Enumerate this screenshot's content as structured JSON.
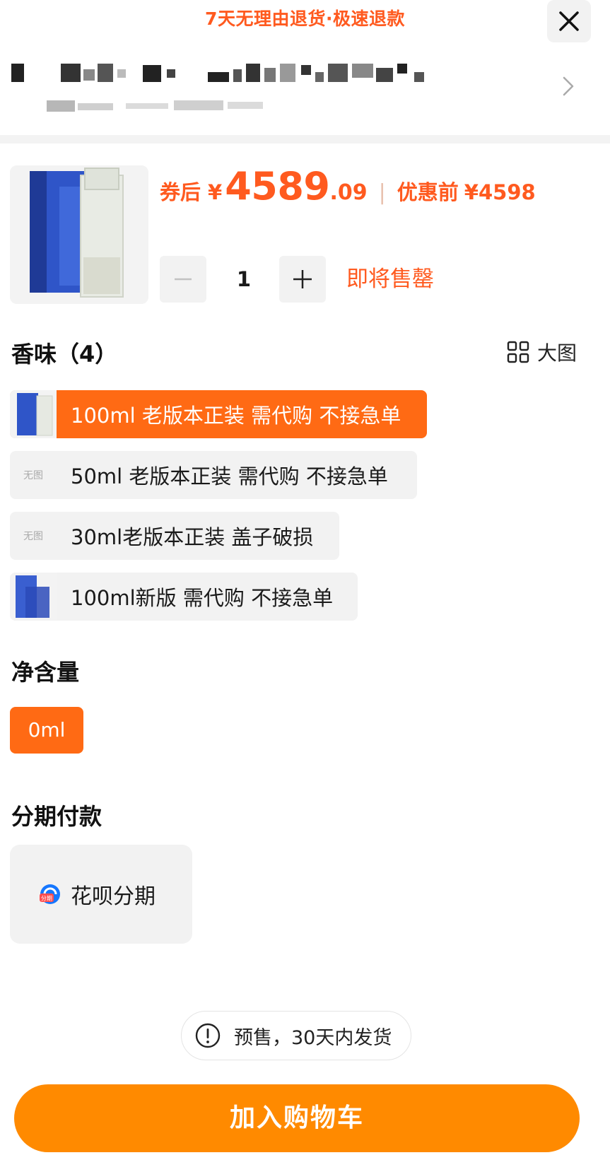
{
  "banner": {
    "text": "7天无理由退货·极速退款"
  },
  "product": {
    "price_label": "券后",
    "currency": "¥",
    "price_integer": "4589",
    "price_decimal": ".09",
    "original_label": "优惠前",
    "original_price": "¥4598",
    "quantity": "1",
    "stock_status": "即将售罄"
  },
  "scent": {
    "title": "香味（4）",
    "big_view_label": "大图",
    "options": [
      {
        "label": "100ml 老版本正装 需代购 不接急单",
        "image": "thumb",
        "selected": true
      },
      {
        "label": "50ml 老版本正装 需代购 不接急单",
        "image": "无图",
        "selected": false
      },
      {
        "label": "30ml老版本正装 盖子破损",
        "image": "无图",
        "selected": false
      },
      {
        "label": "100ml新版 需代购 不接急单",
        "image": "thumb",
        "selected": false
      }
    ]
  },
  "volume": {
    "title": "净含量",
    "selected": "0ml"
  },
  "installment": {
    "title": "分期付款",
    "option_label": "花呗分期",
    "icon_badge": "分期"
  },
  "notice": {
    "text": "预售，30天内发货"
  },
  "cart": {
    "button_label": "加入购物车"
  },
  "colors": {
    "accent": "#ff6a14",
    "cart_button": "#ff8a00",
    "price": "#ff5a1f"
  }
}
